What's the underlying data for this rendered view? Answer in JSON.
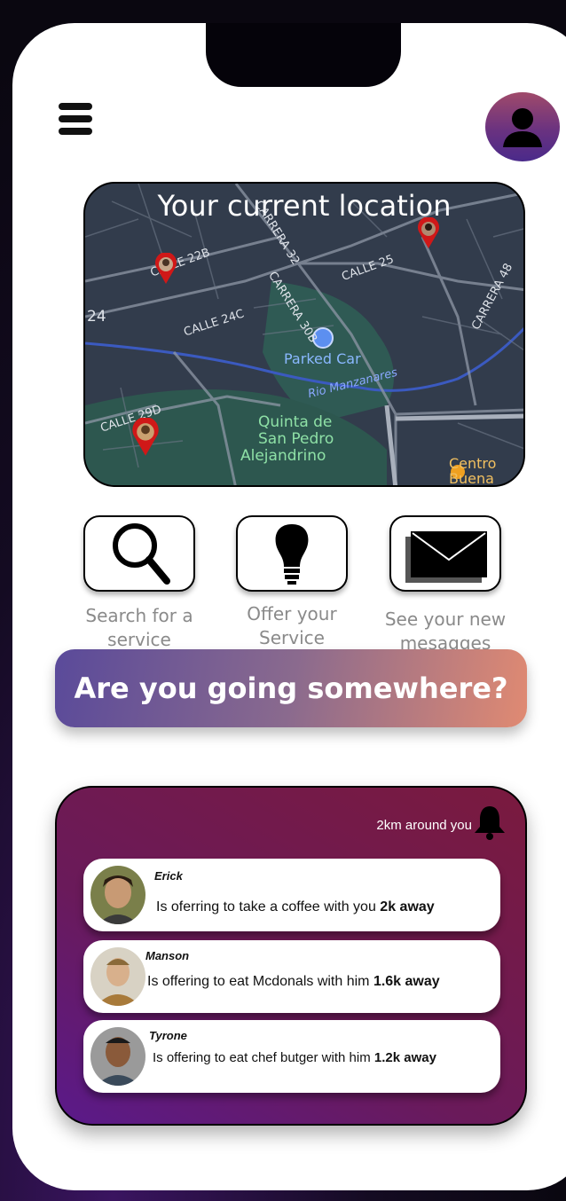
{
  "map": {
    "title": "Your current location",
    "streets": [
      "CALLE 22B",
      "CARRERA 32",
      "CALLE 25",
      "CARRERA 48",
      "CALLE 24C",
      "CARRERA 30B",
      "24",
      "CALLE 29D",
      "Rio Manzanares"
    ],
    "parked_label": "Parked Car",
    "poi": {
      "line1": "Quinta de",
      "line2": "San Pedro",
      "line3": "Alejandrino"
    },
    "centro": {
      "line1": "Centro",
      "line2": "Buena"
    }
  },
  "actions": [
    {
      "line1": "Search for a",
      "line2": "service"
    },
    {
      "line1": "Offer your",
      "line2": "Service"
    },
    {
      "line1": "See your new",
      "line2": "mesagges"
    }
  ],
  "cta": {
    "label": "Are you going somewhere?"
  },
  "feed": {
    "radius_label": "2km around you",
    "items": [
      {
        "name": "Erick",
        "text": "Is oferring to take a coffee with you ",
        "distance": "2k away"
      },
      {
        "name": "Manson",
        "text": "Is offering to eat Mcdonals with him ",
        "distance": "1.6k away"
      },
      {
        "name": "Tyrone",
        "text": "Is offering to eat chef butger with him ",
        "distance": "1.2k away"
      }
    ]
  },
  "colors": {
    "cta_start": "#5a4a9a",
    "cta_end": "#e08a72",
    "feed_start": "#5a1a8a",
    "feed_end": "#7a1a3e",
    "pin": "#d01818"
  }
}
